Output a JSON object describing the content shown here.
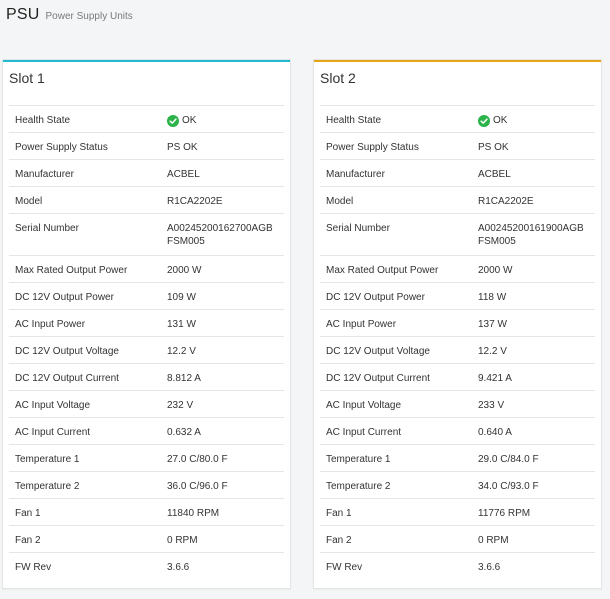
{
  "header": {
    "title": "PSU",
    "subtitle": "Power Supply Units"
  },
  "colors": {
    "slot1_accent": "#22b8cf",
    "slot2_accent": "#e8a317",
    "ok_green": "#2bb34a"
  },
  "slots": [
    {
      "title": "Slot 1",
      "rows": [
        {
          "label": "Health State",
          "value": "OK"
        },
        {
          "label": "Power Supply Status",
          "value": "PS OK"
        },
        {
          "label": "Manufacturer",
          "value": "ACBEL"
        },
        {
          "label": "Model",
          "value": "R1CA2202E"
        },
        {
          "label": "Serial Number",
          "value": "A00245200162700AGB",
          "value2": "FSM005"
        },
        {
          "label": "Max Rated Output Power",
          "value": "2000 W"
        },
        {
          "label": "DC 12V Output Power",
          "value": "109 W"
        },
        {
          "label": "AC Input Power",
          "value": "131 W"
        },
        {
          "label": "DC 12V Output Voltage",
          "value": "12.2 V"
        },
        {
          "label": "DC 12V Output Current",
          "value": "8.812 A"
        },
        {
          "label": "AC Input Voltage",
          "value": "232 V"
        },
        {
          "label": "AC Input Current",
          "value": "0.632 A"
        },
        {
          "label": "Temperature 1",
          "value": "27.0 C/80.0 F"
        },
        {
          "label": "Temperature 2",
          "value": "36.0 C/96.0 F"
        },
        {
          "label": "Fan 1",
          "value": "11840 RPM"
        },
        {
          "label": "Fan 2",
          "value": "0 RPM"
        },
        {
          "label": "FW Rev",
          "value": "3.6.6"
        }
      ]
    },
    {
      "title": "Slot 2",
      "rows": [
        {
          "label": "Health State",
          "value": "OK"
        },
        {
          "label": "Power Supply Status",
          "value": "PS OK"
        },
        {
          "label": "Manufacturer",
          "value": "ACBEL"
        },
        {
          "label": "Model",
          "value": "R1CA2202E"
        },
        {
          "label": "Serial Number",
          "value": "A00245200161900AGB",
          "value2": "FSM005"
        },
        {
          "label": "Max Rated Output Power",
          "value": "2000 W"
        },
        {
          "label": "DC 12V Output Power",
          "value": "118 W"
        },
        {
          "label": "AC Input Power",
          "value": "137 W"
        },
        {
          "label": "DC 12V Output Voltage",
          "value": "12.2 V"
        },
        {
          "label": "DC 12V Output Current",
          "value": "9.421 A"
        },
        {
          "label": "AC Input Voltage",
          "value": "233 V"
        },
        {
          "label": "AC Input Current",
          "value": "0.640 A"
        },
        {
          "label": "Temperature 1",
          "value": "29.0 C/84.0 F"
        },
        {
          "label": "Temperature 2",
          "value": "34.0 C/93.0 F"
        },
        {
          "label": "Fan 1",
          "value": "11776 RPM"
        },
        {
          "label": "Fan 2",
          "value": "0 RPM"
        },
        {
          "label": "FW Rev",
          "value": "3.6.6"
        }
      ]
    }
  ]
}
